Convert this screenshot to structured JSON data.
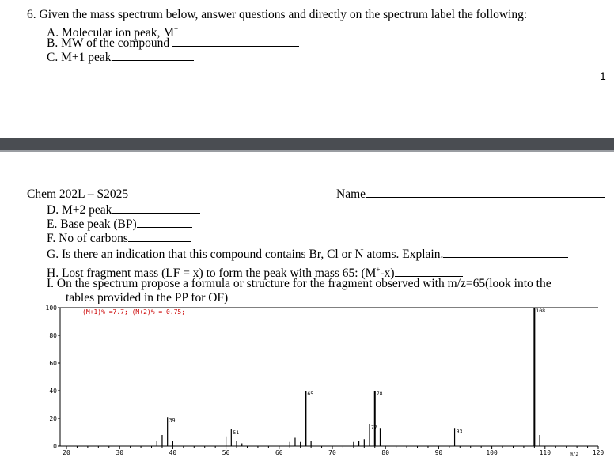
{
  "page1": {
    "question": "6.  Given the mass spectrum below, answer questions and directly on the spectrum label the following:",
    "items": [
      {
        "label": "A.  Molecular ion peak, M",
        "sup": "+"
      },
      {
        "label": "B.  MW of the compound",
        "sup": ""
      },
      {
        "label": "C.  M+1 peak",
        "sup": ""
      }
    ],
    "page_number": "1"
  },
  "page2": {
    "course": "Chem 202L – S2025",
    "name_label": "Name",
    "items": {
      "d": "D.  M+2 peak",
      "e": "E.  Base peak (BP)",
      "f": "F.  No of carbons",
      "g": "G.  Is there an indication that this compound contains Br, Cl or N atoms. Explain.",
      "h_pre": "H.  Lost fragment mass (LF = x) to form the peak with mass 65: (M",
      "h_sup": "+",
      "h_post": "-x)",
      "i_line1": "I.   On the spectrum propose a formula or structure for the fragment observed with m/z=65(look into the",
      "i_line2": "tables provided in the PP for OF)"
    }
  },
  "chart_data": {
    "type": "bar",
    "annotation": "(M+1)% =7.7; (M+2)% = 0.75;",
    "annotation_color": "#cc0000",
    "xlabel": "m/z",
    "xlim": [
      20,
      120
    ],
    "ylim": [
      0,
      100
    ],
    "x_ticks": [
      20,
      30,
      40,
      50,
      60,
      70,
      80,
      90,
      100,
      110,
      120
    ],
    "y_ticks": [
      0,
      20,
      40,
      60,
      80,
      100
    ],
    "peak_labels": [
      "39",
      "51",
      "65",
      "77",
      "78",
      "93",
      "108"
    ],
    "peaks": [
      {
        "x": 37,
        "y": 4
      },
      {
        "x": 38,
        "y": 8
      },
      {
        "x": 39,
        "y": 21
      },
      {
        "x": 40,
        "y": 4
      },
      {
        "x": 50,
        "y": 7
      },
      {
        "x": 51,
        "y": 12
      },
      {
        "x": 52,
        "y": 4
      },
      {
        "x": 53,
        "y": 2
      },
      {
        "x": 62,
        "y": 3
      },
      {
        "x": 63,
        "y": 6
      },
      {
        "x": 64,
        "y": 3
      },
      {
        "x": 65,
        "y": 40
      },
      {
        "x": 66,
        "y": 4
      },
      {
        "x": 74,
        "y": 3
      },
      {
        "x": 75,
        "y": 4
      },
      {
        "x": 76,
        "y": 5
      },
      {
        "x": 77,
        "y": 16
      },
      {
        "x": 78,
        "y": 40
      },
      {
        "x": 79,
        "y": 13
      },
      {
        "x": 93,
        "y": 13
      },
      {
        "x": 108,
        "y": 100
      },
      {
        "x": 109,
        "y": 8
      }
    ]
  }
}
